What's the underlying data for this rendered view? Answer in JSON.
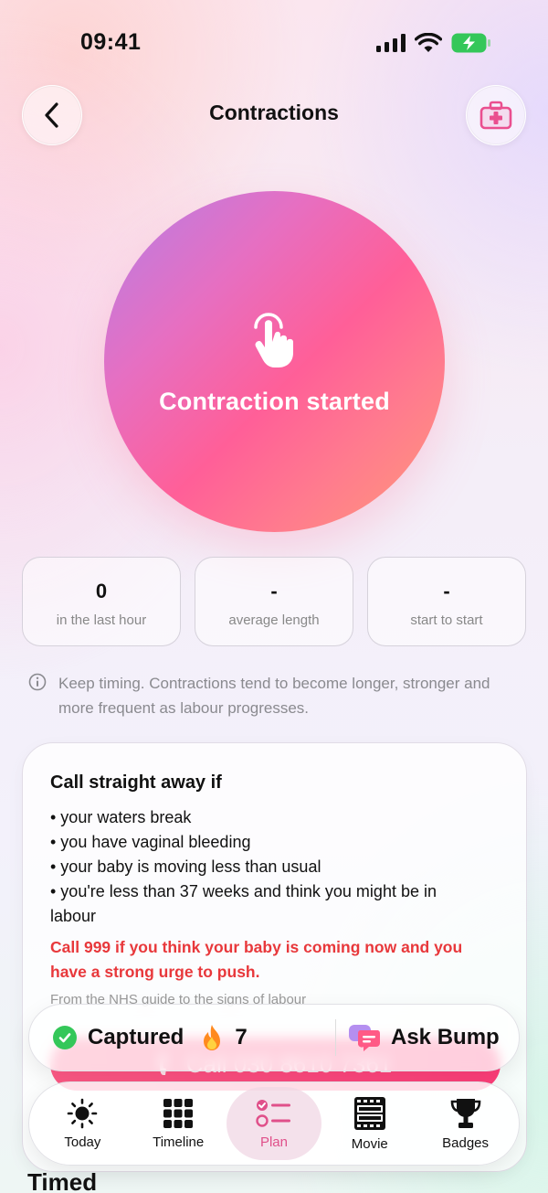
{
  "status_bar": {
    "time": "09:41"
  },
  "header": {
    "title": "Contractions"
  },
  "timer_button": {
    "label": "Contraction started"
  },
  "stats": [
    {
      "value": "0",
      "label": "in the last hour"
    },
    {
      "value": "-",
      "label": "average length"
    },
    {
      "value": "-",
      "label": "start to start"
    }
  ],
  "info_note": "Keep timing. Contractions tend to become longer, stronger and more frequent as labour progresses.",
  "call_card": {
    "title": "Call straight away if",
    "items": [
      "• your waters break",
      "• you have vaginal bleeding",
      "• your baby is moving less than usual",
      "• you're less than 37 weeks and think you might be in labour"
    ],
    "warning": "Call 999 if you think your baby is coming now and you have a strong urge to push.",
    "source": "From the NHS guide to the signs of labour",
    "call_button_label": "Call 030 8610 7361"
  },
  "captured_bar": {
    "captured_label": "Captured",
    "streak_count": "7",
    "ask_label": "Ask Bump"
  },
  "tabs": [
    {
      "label": "Today",
      "icon": "sun-icon"
    },
    {
      "label": "Timeline",
      "icon": "grid-icon"
    },
    {
      "label": "Plan",
      "icon": "checklist-icon",
      "active": true
    },
    {
      "label": "Movie",
      "icon": "film-icon"
    },
    {
      "label": "Badges",
      "icon": "trophy-icon"
    }
  ],
  "section_heading": "Timed",
  "colors": {
    "accent": "#e0508a",
    "warning": "#e8383b",
    "success": "#34c759"
  }
}
